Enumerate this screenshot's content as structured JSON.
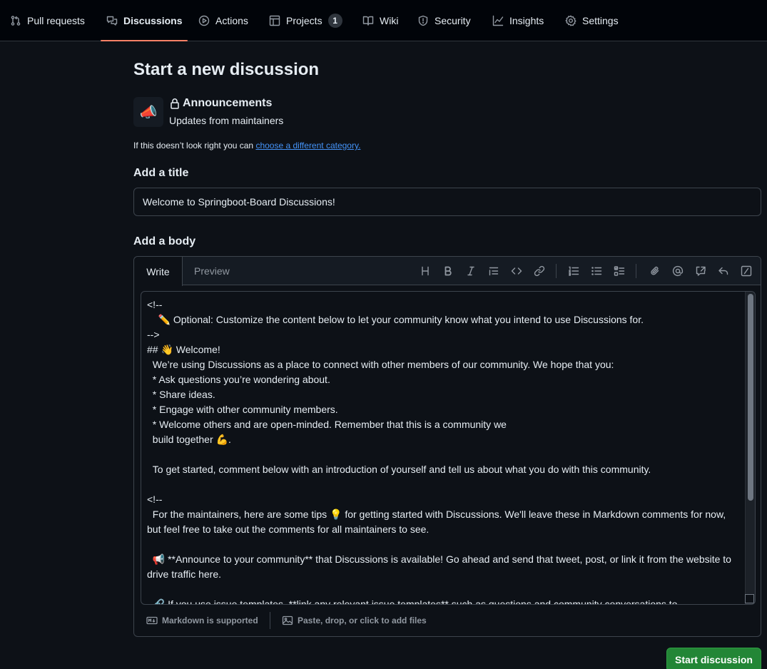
{
  "nav": {
    "tabs": [
      {
        "label": "Pull requests",
        "icon": "git-pull-request-icon"
      },
      {
        "label": "Discussions",
        "icon": "comment-discussion-icon"
      },
      {
        "label": "Actions",
        "icon": "play-icon"
      },
      {
        "label": "Projects",
        "icon": "table-icon",
        "count": "1"
      },
      {
        "label": "Wiki",
        "icon": "book-icon"
      },
      {
        "label": "Security",
        "icon": "shield-icon"
      },
      {
        "label": "Insights",
        "icon": "graph-icon"
      },
      {
        "label": "Settings",
        "icon": "gear-icon"
      }
    ],
    "active_tab": "Discussions",
    "active_color": "#f78166"
  },
  "page": {
    "title": "Start a new discussion",
    "category": {
      "emoji": "📣",
      "name": "Announcements",
      "description": "Updates from maintainers",
      "hint_prefix": "If this doesn’t look right you can ",
      "hint_link": "choose a different category."
    }
  },
  "form": {
    "title_label": "Add a title",
    "title_value": "Welcome to Springboot-Board Discussions!",
    "body_label": "Add a body",
    "tabs": {
      "write": "Write",
      "preview": "Preview"
    },
    "toolbar": [
      "heading-icon",
      "bold-icon",
      "italic-icon",
      "quote-icon",
      "code-icon",
      "link-icon",
      "numbered-list-icon",
      "bulleted-list-icon",
      "task-list-icon",
      "attach-icon",
      "mention-icon",
      "cross-reference-icon",
      "reply-icon",
      "slash-commands-icon"
    ],
    "body_text": "<!--\n    ✏️ Optional: Customize the content below to let your community know what you intend to use Discussions for.\n-->\n## 👋 Welcome!\n  We’re using Discussions as a place to connect with other members of our community. We hope that you:\n  * Ask questions you’re wondering about.\n  * Share ideas.\n  * Engage with other community members.\n  * Welcome others and are open-minded. Remember that this is a community we\n  build together 💪.\n\n  To get started, comment below with an introduction of yourself and tell us about what you do with this community.\n\n<!--\n  For the maintainers, here are some tips 💡 for getting started with Discussions. We'll leave these in Markdown comments for now, but feel free to take out the comments for all maintainers to see.\n\n  📢 **Announce to your community** that Discussions is available! Go ahead and send that tweet, post, or link it from the website to drive traffic here.\n\n  🔗 If you use issue templates, **link any relevant issue templates** such as questions and community conversations to",
    "markdown_note": "Markdown is supported",
    "attach_note": "Paste, drop, or click to add files",
    "submit_label": "Start discussion",
    "submit_color": "#238636"
  }
}
